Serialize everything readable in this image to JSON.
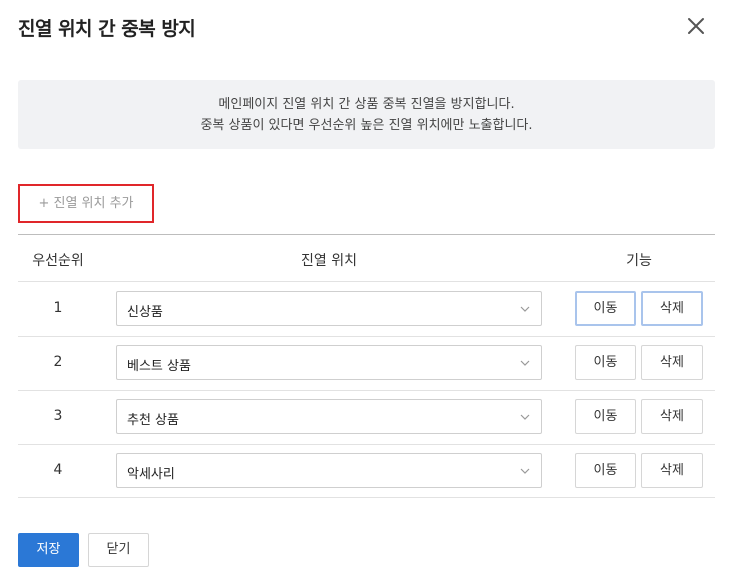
{
  "dialog": {
    "title": "진열 위치 간 중복 방지",
    "close_icon": "close-icon"
  },
  "notice": {
    "line1": "메인페이지 진열 위치 간 상품 중복 진열을 방지합니다.",
    "line2": "중복 상품이 있다면 우선순위 높은 진열 위치에만 노출합니다."
  },
  "add_button": {
    "label": "+ 진열 위치 추가"
  },
  "table": {
    "headers": {
      "rank": "우선순위",
      "location": "진열 위치",
      "actions": "기능"
    },
    "rows": [
      {
        "rank": "1",
        "location": "신상품",
        "move": "이동",
        "delete": "삭제"
      },
      {
        "rank": "2",
        "location": "베스트 상품",
        "move": "이동",
        "delete": "삭제"
      },
      {
        "rank": "3",
        "location": "추천 상품",
        "move": "이동",
        "delete": "삭제"
      },
      {
        "rank": "4",
        "location": "악세사리",
        "move": "이동",
        "delete": "삭제"
      }
    ]
  },
  "footer": {
    "save_label": "저장",
    "close_label": "닫기"
  },
  "colors": {
    "primary": "#2b78d6",
    "highlight_border": "#e0262a",
    "notice_bg": "#f1f2f4"
  }
}
